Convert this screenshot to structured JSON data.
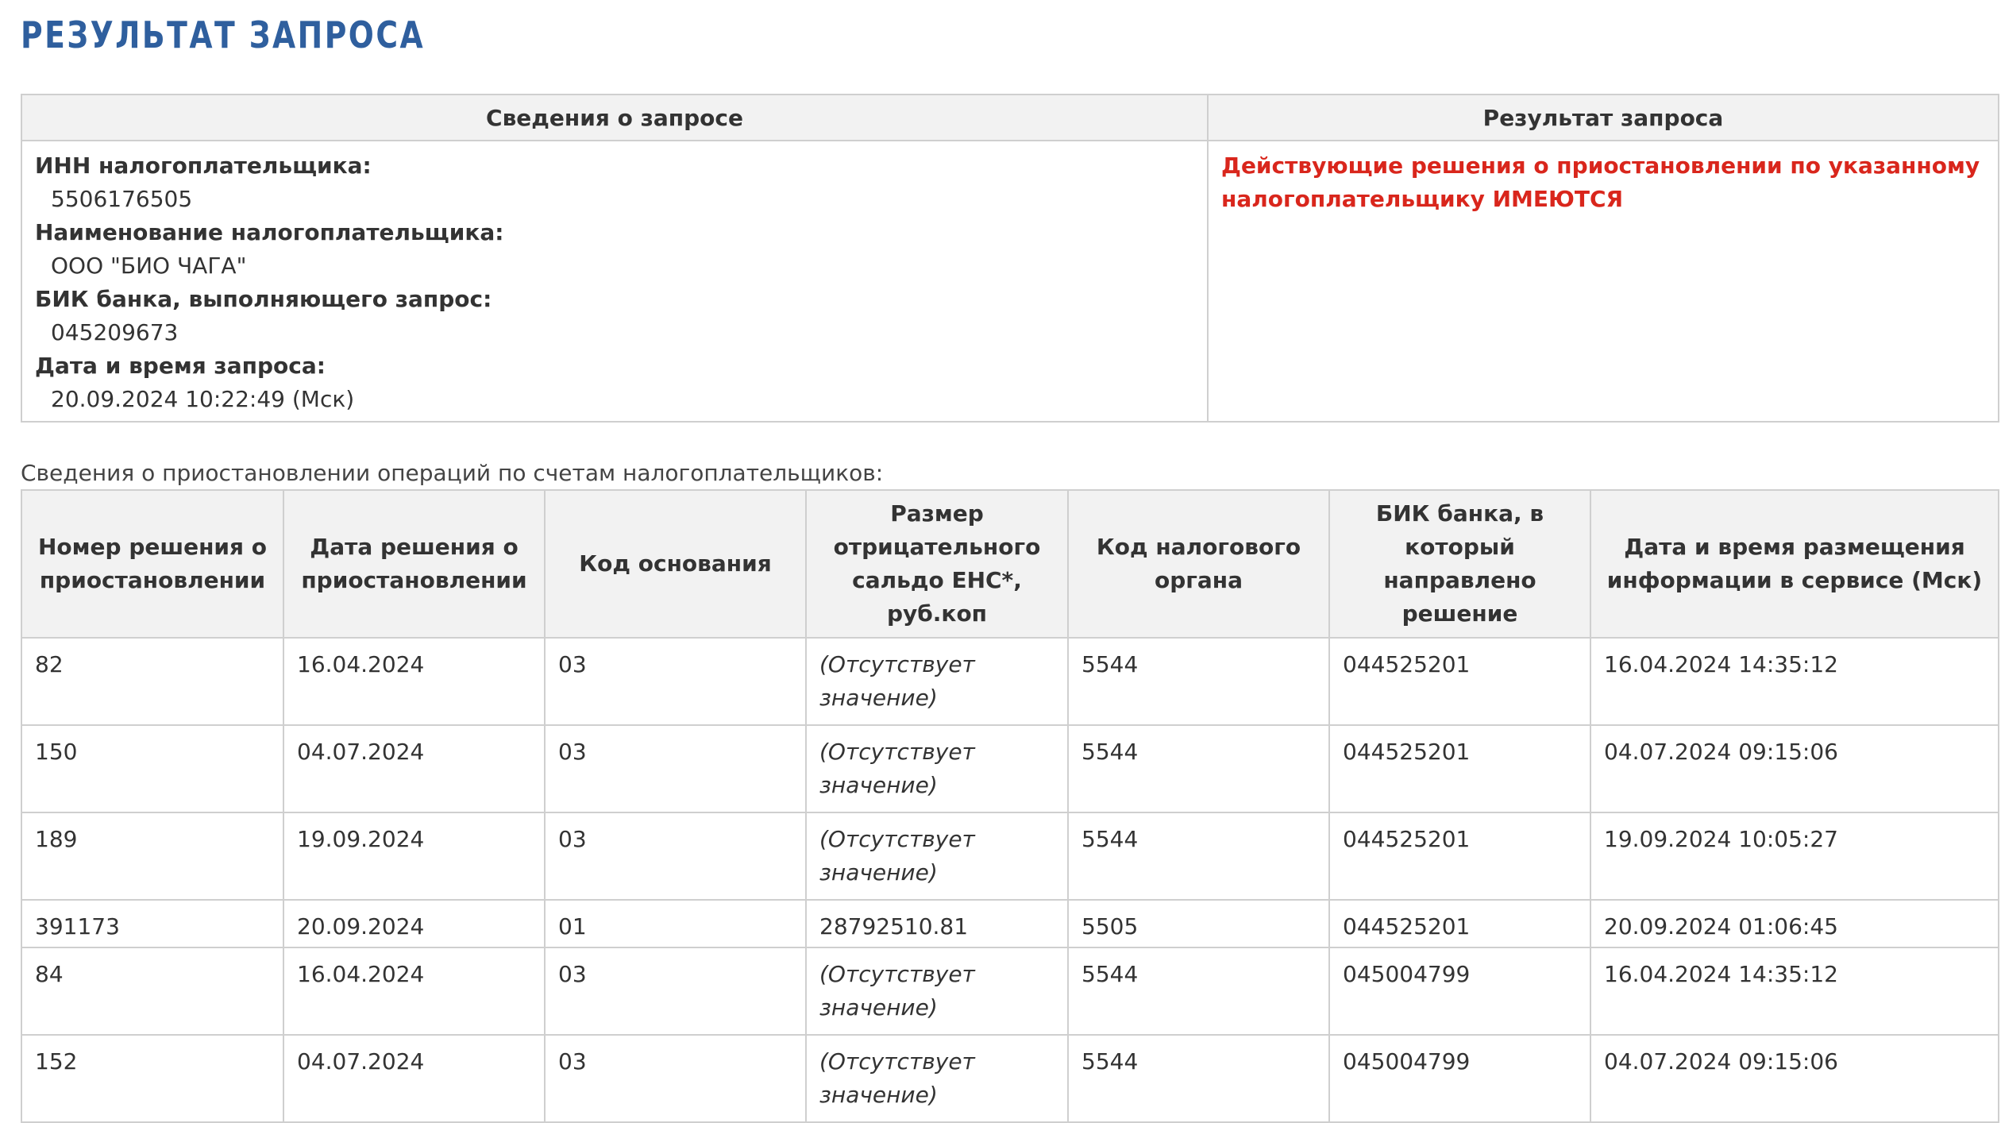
{
  "page": {
    "title": "РЕЗУЛЬТАТ ЗАПРОСА"
  },
  "info": {
    "header_left": "Сведения о запросе",
    "header_right": "Результат запроса",
    "fields": [
      {
        "label": "ИНН налогоплательщика:",
        "value": "5506176505"
      },
      {
        "label": "Наименование налогоплательщика:",
        "value": "ООО \"БИО ЧАГА\""
      },
      {
        "label": "БИК банка, выполняющего запрос:",
        "value": "045209673"
      },
      {
        "label": "Дата и время запроса:",
        "value": "20.09.2024 10:22:49 (Мск)"
      }
    ],
    "result": "Действующие решения о приостановлении по указанному налогоплательщику ИМЕЮТСЯ",
    "result_color": "#d9261c"
  },
  "operations": {
    "caption": "Сведения о приостановлении операций по счетам налогоплательщиков:",
    "columns": [
      "Номер решения о приостановлении",
      "Дата решения о приостановлении",
      "Код основания",
      "Размер отрицательного сальдо ЕНС*, руб.коп",
      "Код налогового органа",
      "БИК банка, в который направлено решение",
      "Дата и время размещения информации в сервисе (Мск)"
    ],
    "rows": [
      {
        "number": "82",
        "date": "16.04.2024",
        "code": "03",
        "saldo": "(Отсутствует значение)",
        "saldo_missing": true,
        "tax_office": "5544",
        "bik": "044525201",
        "posted": "16.04.2024 14:35:12"
      },
      {
        "number": "150",
        "date": "04.07.2024",
        "code": "03",
        "saldo": "(Отсутствует значение)",
        "saldo_missing": true,
        "tax_office": "5544",
        "bik": "044525201",
        "posted": "04.07.2024 09:15:06"
      },
      {
        "number": "189",
        "date": "19.09.2024",
        "code": "03",
        "saldo": "(Отсутствует значение)",
        "saldo_missing": true,
        "tax_office": "5544",
        "bik": "044525201",
        "posted": "19.09.2024 10:05:27"
      },
      {
        "number": "391173",
        "date": "20.09.2024",
        "code": "01",
        "saldo": "28792510.81",
        "saldo_missing": false,
        "tax_office": "5505",
        "bik": "044525201",
        "posted": "20.09.2024 01:06:45"
      },
      {
        "number": "84",
        "date": "16.04.2024",
        "code": "03",
        "saldo": "(Отсутствует значение)",
        "saldo_missing": true,
        "tax_office": "5544",
        "bik": "045004799",
        "posted": "16.04.2024 14:35:12"
      },
      {
        "number": "152",
        "date": "04.07.2024",
        "code": "03",
        "saldo": "(Отсутствует значение)",
        "saldo_missing": true,
        "tax_office": "5544",
        "bik": "045004799",
        "posted": "04.07.2024 09:15:06"
      }
    ]
  },
  "colors": {
    "title": "#2f5f9e",
    "header_bg": "#f2f2f2",
    "border": "#cfcfcf",
    "missing_text": "#999999"
  }
}
